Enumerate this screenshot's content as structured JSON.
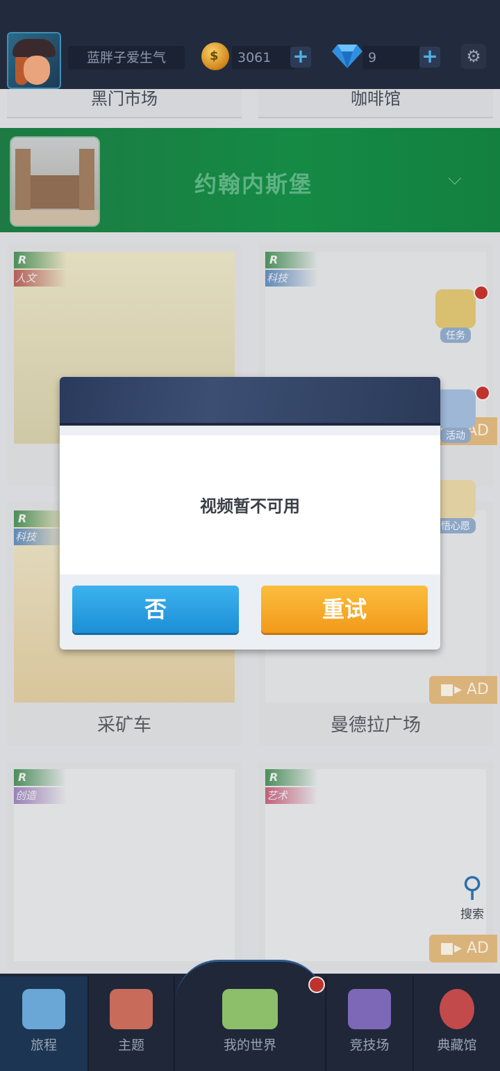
{
  "header": {
    "username": "蓝胖子爱生气",
    "coins": "3061",
    "gems": "9",
    "plus_symbol": "+",
    "settings_icon": "gear-icon"
  },
  "top_cards": [
    "黑门市场",
    "咖啡馆"
  ],
  "banner": {
    "title": "约翰内斯堡",
    "chevron_icon": "chevron-down-icon"
  },
  "cards": [
    {
      "rank": "R",
      "category": "人文",
      "label": ""
    },
    {
      "rank": "R",
      "category": "科技",
      "label": ""
    },
    {
      "rank": "R",
      "category": "科技",
      "label": "采矿车"
    },
    {
      "rank": "R",
      "category": "",
      "label": "曼德拉广场"
    },
    {
      "rank": "R",
      "category": "创造",
      "label": ""
    },
    {
      "rank": "R",
      "category": "艺术",
      "label": ""
    }
  ],
  "ad_label": "AD",
  "side_buttons": {
    "tasks": "任务",
    "events": "活动",
    "heart": "悟心愿",
    "search": "搜索"
  },
  "dialog": {
    "message": "视频暂不可用",
    "no_label": "否",
    "retry_label": "重试"
  },
  "bottom_nav": [
    "旅程",
    "主题",
    "我的世界",
    "竞技场",
    "典藏馆"
  ],
  "colors": {
    "no_button": "#1c8fd6",
    "retry_button": "#f29a1a",
    "banner": "#158a45"
  }
}
